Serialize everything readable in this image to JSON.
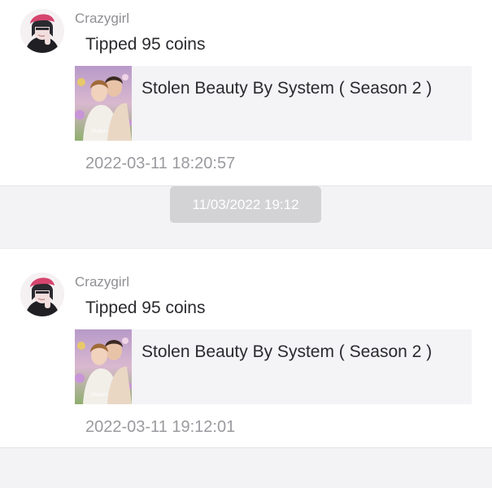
{
  "messages": [
    {
      "username": "Crazygirl",
      "text": "Tipped 95 coins",
      "book_title": "Stolen Beauty By System ( Season 2 )",
      "timestamp": "2022-03-11 18:20:57"
    },
    {
      "username": "Crazygirl",
      "text": "Tipped 95 coins",
      "book_title": "Stolen Beauty By System ( Season 2 )",
      "timestamp": "2022-03-11 19:12:01"
    }
  ],
  "date_separator": "11/03/2022 19:12",
  "colors": {
    "card_bg": "#ffffff",
    "page_bg": "#f3f3f5",
    "book_bg": "#f4f3f6",
    "chip_bg": "#d3d3d6",
    "text_primary": "#2a2a2e",
    "text_secondary": "#8f8f94",
    "avatar_hat": "#d6456e"
  }
}
